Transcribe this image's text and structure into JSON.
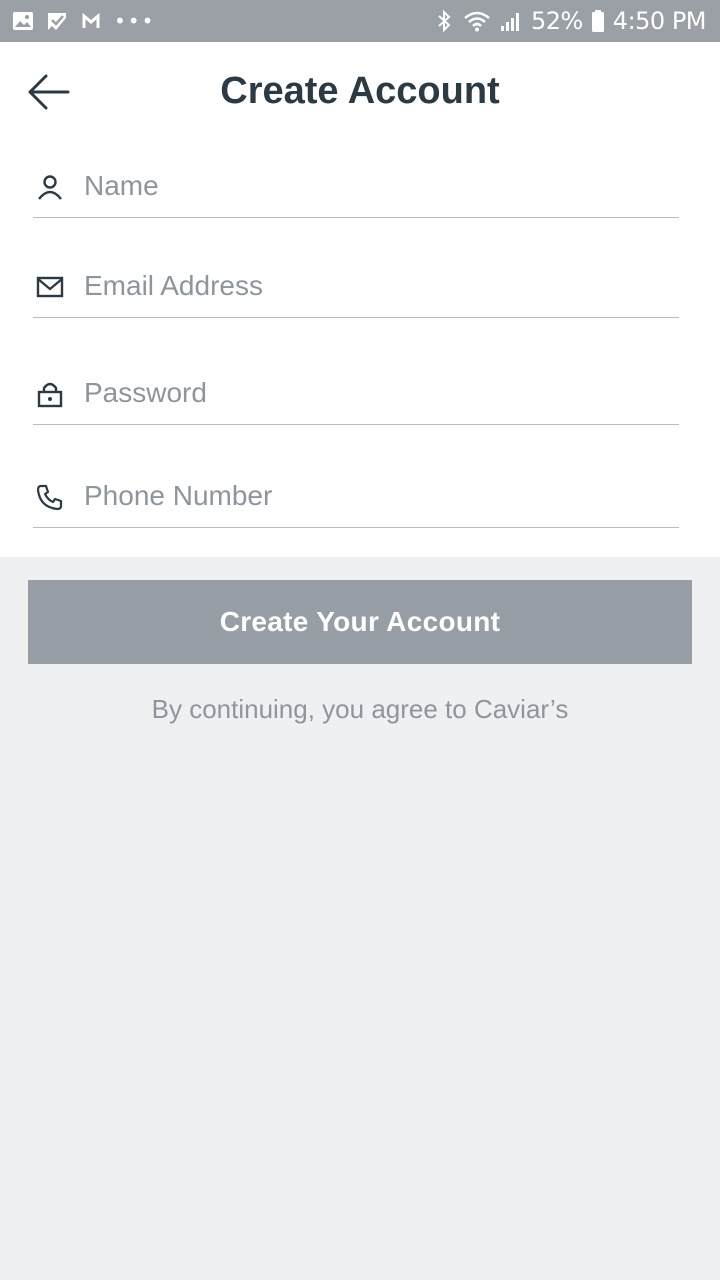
{
  "status_bar": {
    "icons_left": [
      "image-icon",
      "check-icon",
      "gmail-icon",
      "more-dots-icon"
    ],
    "more_dots": "•••",
    "battery_percent": "52%",
    "time": "4:50 PM"
  },
  "header": {
    "title": "Create Account"
  },
  "form": {
    "name": {
      "placeholder": "Name",
      "value": ""
    },
    "email": {
      "placeholder": "Email Address",
      "value": ""
    },
    "password": {
      "placeholder": "Password",
      "value": ""
    },
    "phone": {
      "placeholder": "Phone Number",
      "value": ""
    }
  },
  "actions": {
    "create_label": "Create Your Account"
  },
  "footer": {
    "terms": "By continuing, you agree to Caviar’s"
  },
  "colors": {
    "status_bar_bg": "#9aa0a6",
    "title": "#2c3a44",
    "placeholder": "#8e959c",
    "button_bg": "#979ea5",
    "page_bg": "#eff0f2"
  }
}
